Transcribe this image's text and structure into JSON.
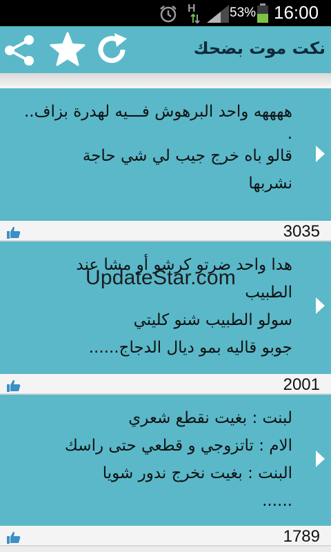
{
  "status_bar": {
    "time": "16:00",
    "battery_percent": "53%",
    "network_type": "H",
    "icons": [
      "alarm-icon",
      "network-data-icon",
      "signal-icon",
      "battery-icon"
    ]
  },
  "toolbar": {
    "title": "نكت موت بضحك",
    "share_icon": "share-icon",
    "favorite_icon": "star-icon",
    "refresh_icon": "refresh-icon"
  },
  "cards": [
    {
      "lines": [
        "ههههه واحد البرهوش فـــيه لهدرة بزاف..",
        ".",
        "قالو باه خرج جيب لي شي حاجة",
        "نشربها"
      ],
      "likes": "3035"
    },
    {
      "lines": [
        "هدا واحد ضرتو كرشو أو مشا عند",
        "الطبيب",
        "سولو الطبيب شنو كليتي",
        "جوبو قاليه بمو ديال الدجاج......"
      ],
      "likes": "2001"
    },
    {
      "lines": [
        "لبنت : بغيت نقطع شعري",
        "الام : تاتزوجي و قطعي حتى راسك",
        "البنت : بغيت نخرج ندور شويا",
        "......"
      ],
      "likes": "1789"
    }
  ],
  "watermark": "UpdateStar.com",
  "colors": {
    "toolbar": "#5ab8c9",
    "card": "#5ab8c9",
    "background": "#ececec",
    "status_bar": "#000000"
  }
}
